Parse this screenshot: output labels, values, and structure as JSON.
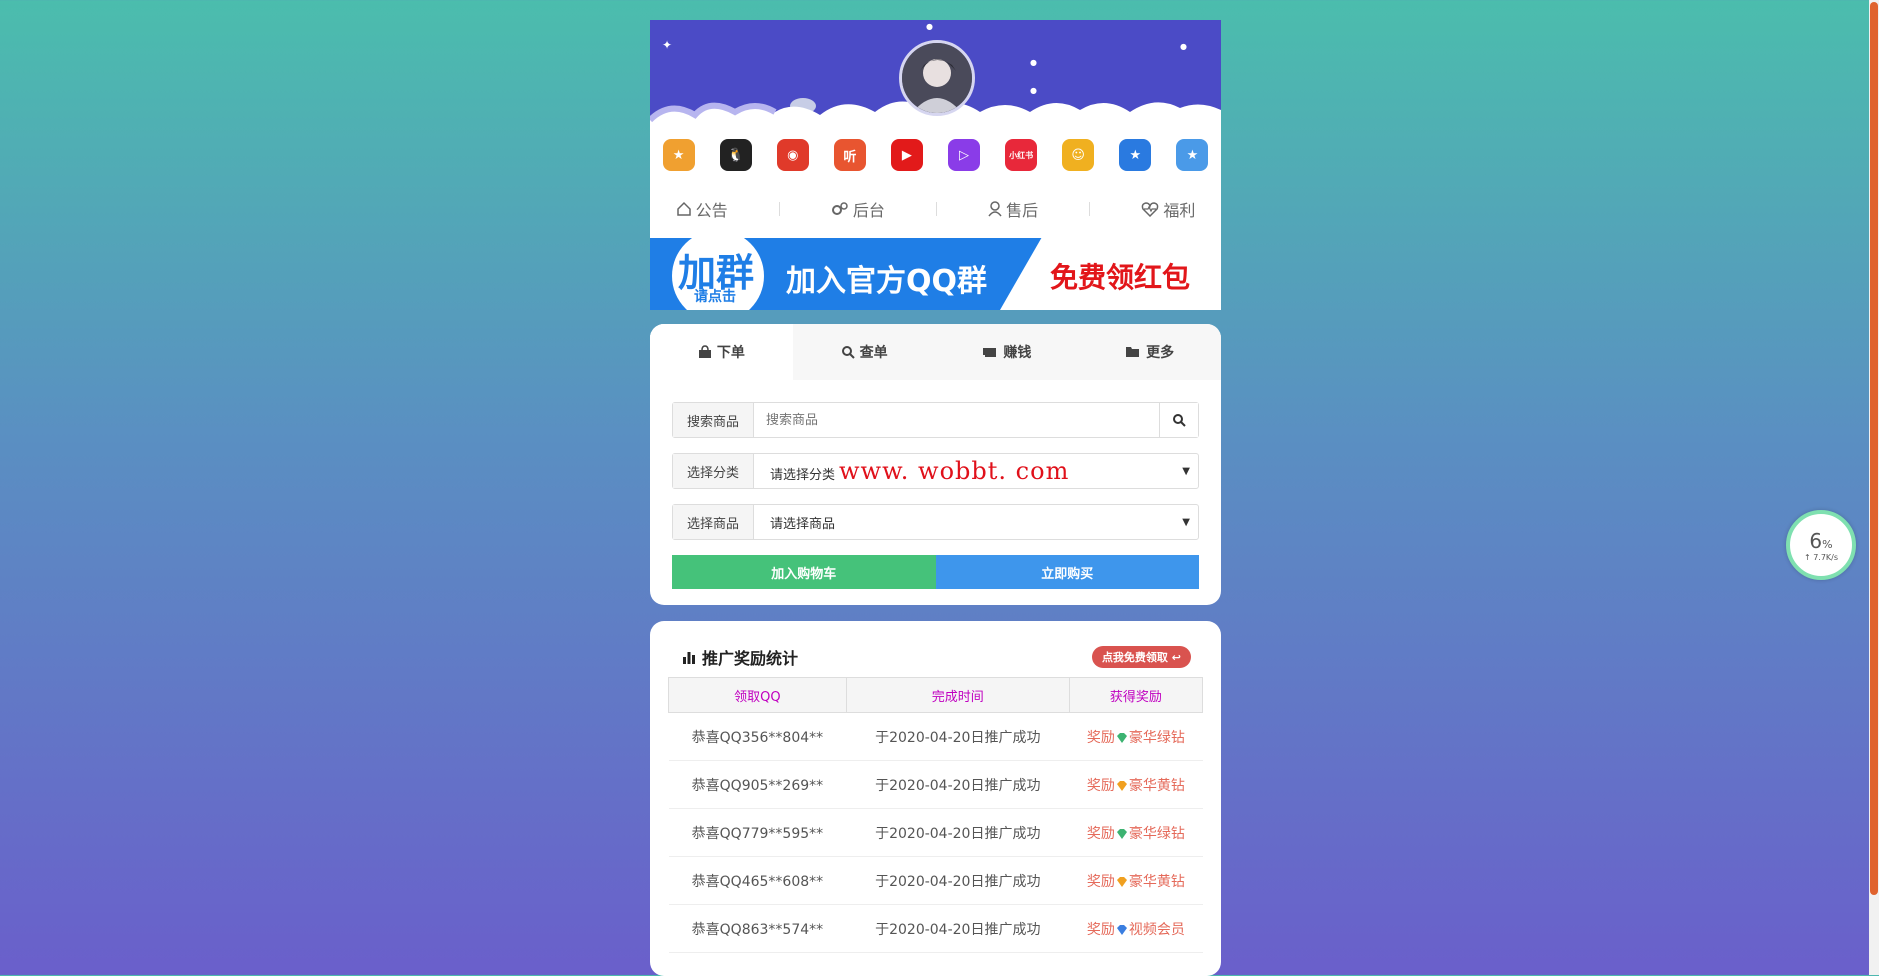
{
  "nav": {
    "items": [
      {
        "label": "公告",
        "icon": "home-icon"
      },
      {
        "label": "后台",
        "icon": "gears-icon"
      },
      {
        "label": "售后",
        "icon": "user-icon"
      },
      {
        "label": "福利",
        "icon": "heartbeat-icon"
      }
    ]
  },
  "header": {
    "app_icons": [
      {
        "name": "medal-icon",
        "color": "#f0a030",
        "glyph": "★"
      },
      {
        "name": "qq-icon",
        "color": "#222222",
        "glyph": "🐧"
      },
      {
        "name": "bird-icon",
        "color": "#e03a2a",
        "glyph": "◉"
      },
      {
        "name": "ting-icon",
        "color": "#e85530",
        "glyph": "听"
      },
      {
        "name": "video-play-icon",
        "color": "#e21a1a",
        "glyph": "▶"
      },
      {
        "name": "tencent-video-icon",
        "color": "#8a3ce8",
        "glyph": "▷"
      },
      {
        "name": "xiaohongshu-icon",
        "color": "#e8283a",
        "glyph": "小红书"
      },
      {
        "name": "face-icon",
        "color": "#f0b020",
        "glyph": "☺"
      },
      {
        "name": "star-badge-icon",
        "color": "#2a7ae0",
        "glyph": "★"
      },
      {
        "name": "blue-star-icon",
        "color": "#4a9ae8",
        "glyph": "★"
      }
    ]
  },
  "banner": {
    "circle_big": "加群",
    "circle_small": "请点击",
    "middle_text": "加入官方QQ群",
    "right_text": "免费领红包"
  },
  "order": {
    "tabs": [
      {
        "label": "下单",
        "icon": "shopping-bag-icon"
      },
      {
        "label": "查单",
        "icon": "search-icon"
      },
      {
        "label": "赚钱",
        "icon": "money-icon"
      },
      {
        "label": "更多",
        "icon": "folder-open-icon"
      }
    ],
    "search_label": "搜索商品",
    "search_placeholder": "搜索商品",
    "category_label": "选择分类",
    "category_value": "请选择分类",
    "watermark": "www. wobbt. com",
    "product_label": "选择商品",
    "product_value": "请选择商品",
    "add_cart": "加入购物车",
    "buy_now": "立即购买"
  },
  "stats": {
    "title": "推广奖励统计",
    "claim_button": "点我免费领取",
    "columns": [
      "领取QQ",
      "完成时间",
      "获得奖励"
    ],
    "rows": [
      {
        "qq": "恭喜QQ356**804**",
        "time": "于2020-04-20日推广成功",
        "reward_prefix": "奖励",
        "reward": "豪华绿钻",
        "gem": "#3cb371"
      },
      {
        "qq": "恭喜QQ905**269**",
        "time": "于2020-04-20日推广成功",
        "reward_prefix": "奖励",
        "reward": "豪华黄钻",
        "gem": "#f0a020"
      },
      {
        "qq": "恭喜QQ779**595**",
        "time": "于2020-04-20日推广成功",
        "reward_prefix": "奖励",
        "reward": "豪华绿钻",
        "gem": "#3cb371"
      },
      {
        "qq": "恭喜QQ465**608**",
        "time": "于2020-04-20日推广成功",
        "reward_prefix": "奖励",
        "reward": "豪华黄钻",
        "gem": "#f0a020"
      },
      {
        "qq": "恭喜QQ863**574**",
        "time": "于2020-04-20日推广成功",
        "reward_prefix": "奖励",
        "reward": "视频会员",
        "gem": "#3a7ee0"
      }
    ]
  },
  "speed_widget": {
    "percent": "6",
    "unit": "%",
    "rate": "↑ 7.7K/s"
  }
}
